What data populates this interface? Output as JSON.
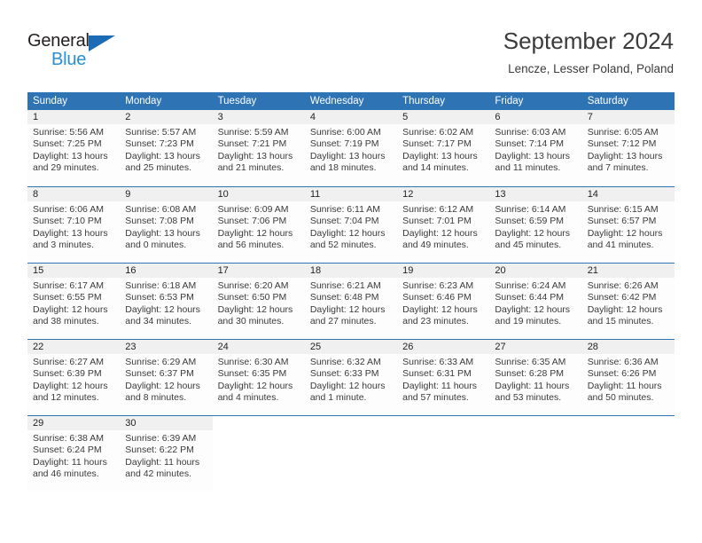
{
  "logo": {
    "word_one": "General",
    "word_two": "Blue",
    "triangle_color": "#1b6cb5",
    "blue_text_color": "#2a8fd4"
  },
  "header": {
    "title": "September 2024",
    "subtitle": "Lencze, Lesser Poland, Poland"
  },
  "theme": {
    "header_blue": "#2e74b5",
    "number_row_gray": "#f0f0f0",
    "body_white": "#fdfdfd",
    "text_dark": "#231f20"
  },
  "calendar": {
    "day_headers": [
      "Sunday",
      "Monday",
      "Tuesday",
      "Wednesday",
      "Thursday",
      "Friday",
      "Saturday"
    ],
    "weeks": [
      {
        "days": [
          {
            "num": "1",
            "sunrise": "Sunrise: 5:56 AM",
            "sunset": "Sunset: 7:25 PM",
            "daylight1": "Daylight: 13 hours",
            "daylight2": "and 29 minutes."
          },
          {
            "num": "2",
            "sunrise": "Sunrise: 5:57 AM",
            "sunset": "Sunset: 7:23 PM",
            "daylight1": "Daylight: 13 hours",
            "daylight2": "and 25 minutes."
          },
          {
            "num": "3",
            "sunrise": "Sunrise: 5:59 AM",
            "sunset": "Sunset: 7:21 PM",
            "daylight1": "Daylight: 13 hours",
            "daylight2": "and 21 minutes."
          },
          {
            "num": "4",
            "sunrise": "Sunrise: 6:00 AM",
            "sunset": "Sunset: 7:19 PM",
            "daylight1": "Daylight: 13 hours",
            "daylight2": "and 18 minutes."
          },
          {
            "num": "5",
            "sunrise": "Sunrise: 6:02 AM",
            "sunset": "Sunset: 7:17 PM",
            "daylight1": "Daylight: 13 hours",
            "daylight2": "and 14 minutes."
          },
          {
            "num": "6",
            "sunrise": "Sunrise: 6:03 AM",
            "sunset": "Sunset: 7:14 PM",
            "daylight1": "Daylight: 13 hours",
            "daylight2": "and 11 minutes."
          },
          {
            "num": "7",
            "sunrise": "Sunrise: 6:05 AM",
            "sunset": "Sunset: 7:12 PM",
            "daylight1": "Daylight: 13 hours",
            "daylight2": "and 7 minutes."
          }
        ]
      },
      {
        "days": [
          {
            "num": "8",
            "sunrise": "Sunrise: 6:06 AM",
            "sunset": "Sunset: 7:10 PM",
            "daylight1": "Daylight: 13 hours",
            "daylight2": "and 3 minutes."
          },
          {
            "num": "9",
            "sunrise": "Sunrise: 6:08 AM",
            "sunset": "Sunset: 7:08 PM",
            "daylight1": "Daylight: 13 hours",
            "daylight2": "and 0 minutes."
          },
          {
            "num": "10",
            "sunrise": "Sunrise: 6:09 AM",
            "sunset": "Sunset: 7:06 PM",
            "daylight1": "Daylight: 12 hours",
            "daylight2": "and 56 minutes."
          },
          {
            "num": "11",
            "sunrise": "Sunrise: 6:11 AM",
            "sunset": "Sunset: 7:04 PM",
            "daylight1": "Daylight: 12 hours",
            "daylight2": "and 52 minutes."
          },
          {
            "num": "12",
            "sunrise": "Sunrise: 6:12 AM",
            "sunset": "Sunset: 7:01 PM",
            "daylight1": "Daylight: 12 hours",
            "daylight2": "and 49 minutes."
          },
          {
            "num": "13",
            "sunrise": "Sunrise: 6:14 AM",
            "sunset": "Sunset: 6:59 PM",
            "daylight1": "Daylight: 12 hours",
            "daylight2": "and 45 minutes."
          },
          {
            "num": "14",
            "sunrise": "Sunrise: 6:15 AM",
            "sunset": "Sunset: 6:57 PM",
            "daylight1": "Daylight: 12 hours",
            "daylight2": "and 41 minutes."
          }
        ]
      },
      {
        "days": [
          {
            "num": "15",
            "sunrise": "Sunrise: 6:17 AM",
            "sunset": "Sunset: 6:55 PM",
            "daylight1": "Daylight: 12 hours",
            "daylight2": "and 38 minutes."
          },
          {
            "num": "16",
            "sunrise": "Sunrise: 6:18 AM",
            "sunset": "Sunset: 6:53 PM",
            "daylight1": "Daylight: 12 hours",
            "daylight2": "and 34 minutes."
          },
          {
            "num": "17",
            "sunrise": "Sunrise: 6:20 AM",
            "sunset": "Sunset: 6:50 PM",
            "daylight1": "Daylight: 12 hours",
            "daylight2": "and 30 minutes."
          },
          {
            "num": "18",
            "sunrise": "Sunrise: 6:21 AM",
            "sunset": "Sunset: 6:48 PM",
            "daylight1": "Daylight: 12 hours",
            "daylight2": "and 27 minutes."
          },
          {
            "num": "19",
            "sunrise": "Sunrise: 6:23 AM",
            "sunset": "Sunset: 6:46 PM",
            "daylight1": "Daylight: 12 hours",
            "daylight2": "and 23 minutes."
          },
          {
            "num": "20",
            "sunrise": "Sunrise: 6:24 AM",
            "sunset": "Sunset: 6:44 PM",
            "daylight1": "Daylight: 12 hours",
            "daylight2": "and 19 minutes."
          },
          {
            "num": "21",
            "sunrise": "Sunrise: 6:26 AM",
            "sunset": "Sunset: 6:42 PM",
            "daylight1": "Daylight: 12 hours",
            "daylight2": "and 15 minutes."
          }
        ]
      },
      {
        "days": [
          {
            "num": "22",
            "sunrise": "Sunrise: 6:27 AM",
            "sunset": "Sunset: 6:39 PM",
            "daylight1": "Daylight: 12 hours",
            "daylight2": "and 12 minutes."
          },
          {
            "num": "23",
            "sunrise": "Sunrise: 6:29 AM",
            "sunset": "Sunset: 6:37 PM",
            "daylight1": "Daylight: 12 hours",
            "daylight2": "and 8 minutes."
          },
          {
            "num": "24",
            "sunrise": "Sunrise: 6:30 AM",
            "sunset": "Sunset: 6:35 PM",
            "daylight1": "Daylight: 12 hours",
            "daylight2": "and 4 minutes."
          },
          {
            "num": "25",
            "sunrise": "Sunrise: 6:32 AM",
            "sunset": "Sunset: 6:33 PM",
            "daylight1": "Daylight: 12 hours",
            "daylight2": "and 1 minute."
          },
          {
            "num": "26",
            "sunrise": "Sunrise: 6:33 AM",
            "sunset": "Sunset: 6:31 PM",
            "daylight1": "Daylight: 11 hours",
            "daylight2": "and 57 minutes."
          },
          {
            "num": "27",
            "sunrise": "Sunrise: 6:35 AM",
            "sunset": "Sunset: 6:28 PM",
            "daylight1": "Daylight: 11 hours",
            "daylight2": "and 53 minutes."
          },
          {
            "num": "28",
            "sunrise": "Sunrise: 6:36 AM",
            "sunset": "Sunset: 6:26 PM",
            "daylight1": "Daylight: 11 hours",
            "daylight2": "and 50 minutes."
          }
        ]
      },
      {
        "days": [
          {
            "num": "29",
            "sunrise": "Sunrise: 6:38 AM",
            "sunset": "Sunset: 6:24 PM",
            "daylight1": "Daylight: 11 hours",
            "daylight2": "and 46 minutes."
          },
          {
            "num": "30",
            "sunrise": "Sunrise: 6:39 AM",
            "sunset": "Sunset: 6:22 PM",
            "daylight1": "Daylight: 11 hours",
            "daylight2": "and 42 minutes."
          },
          {
            "num": "",
            "sunrise": "",
            "sunset": "",
            "daylight1": "",
            "daylight2": ""
          },
          {
            "num": "",
            "sunrise": "",
            "sunset": "",
            "daylight1": "",
            "daylight2": ""
          },
          {
            "num": "",
            "sunrise": "",
            "sunset": "",
            "daylight1": "",
            "daylight2": ""
          },
          {
            "num": "",
            "sunrise": "",
            "sunset": "",
            "daylight1": "",
            "daylight2": ""
          },
          {
            "num": "",
            "sunrise": "",
            "sunset": "",
            "daylight1": "",
            "daylight2": ""
          }
        ]
      }
    ]
  }
}
